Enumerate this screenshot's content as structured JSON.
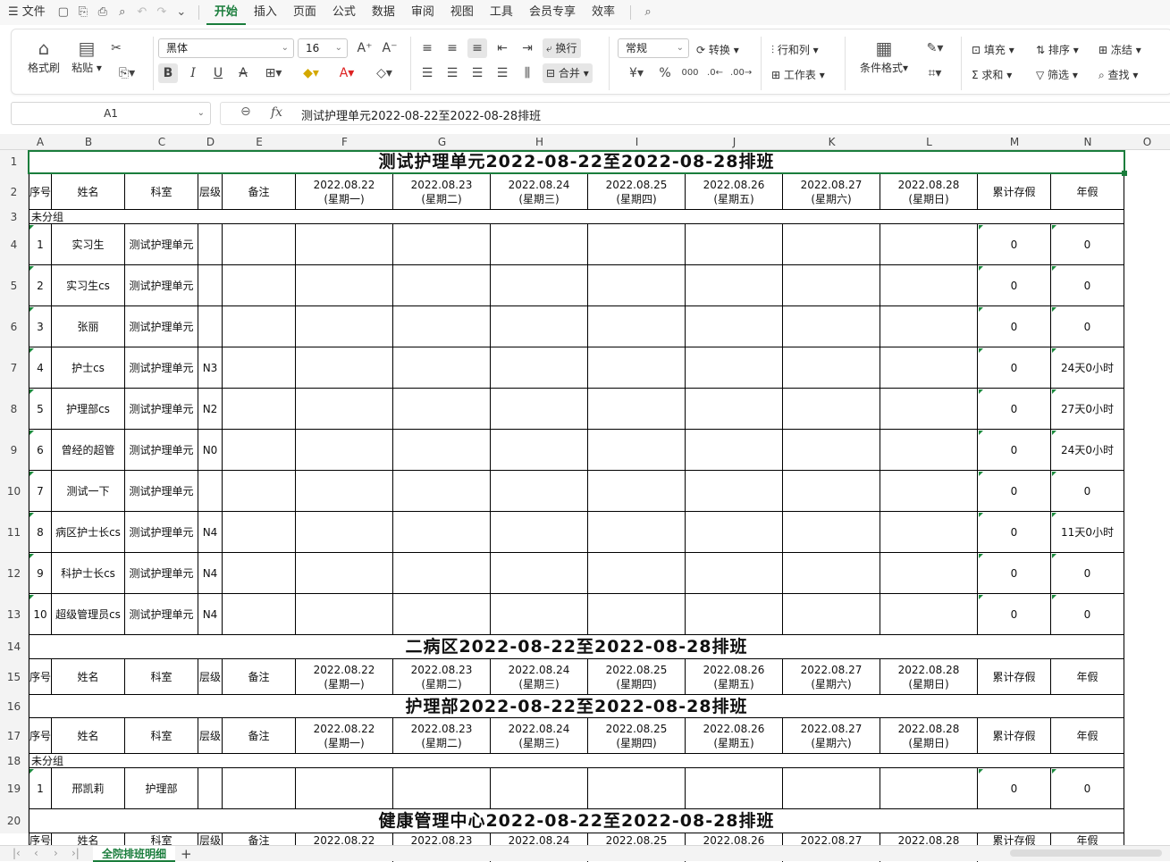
{
  "menu": {
    "file": "文件",
    "tabs": [
      "开始",
      "插入",
      "页面",
      "公式",
      "数据",
      "审阅",
      "视图",
      "工具",
      "会员专享",
      "效率"
    ],
    "active_tab": "开始"
  },
  "ribbon": {
    "format_painter": "格式刷",
    "paste": "粘贴",
    "font_name": "黑体",
    "font_size": "16",
    "wrap": "换行",
    "merge": "合并",
    "number_format": "常规",
    "convert": "转换",
    "row_col": "行和列",
    "worksheet": "工作表",
    "cond_format": "条件格式",
    "fill": "填充",
    "sort": "排序",
    "freeze": "冻结",
    "sum": "求和",
    "filter": "筛选",
    "find": "查找",
    "accent_color": "#1a7d3c"
  },
  "formula_bar": {
    "name_box": "A1",
    "fx_label": "fx",
    "content": "测试护理单元2022-08-22至2022-08-28排班"
  },
  "columns": [
    "A",
    "B",
    "C",
    "D",
    "E",
    "F",
    "G",
    "H",
    "I",
    "J",
    "K",
    "L",
    "M",
    "N",
    "O"
  ],
  "header_labels": {
    "seq": "序号",
    "name": "姓名",
    "dept": "科室",
    "level": "层级",
    "note": "备注",
    "dates": [
      "2022.08.22",
      "2022.08.23",
      "2022.08.24",
      "2022.08.25",
      "2022.08.26",
      "2022.08.27",
      "2022.08.28"
    ],
    "weekdays": [
      "(星期一)",
      "(星期二)",
      "(星期三)",
      "(星期四)",
      "(星期五)",
      "(星期六)",
      "(星期日)"
    ],
    "accum": "累计存假",
    "annual": "年假"
  },
  "group_label": "未分组",
  "sections": [
    {
      "title": "测试护理单元2022-08-22至2022-08-28排班"
    },
    {
      "title": "二病区2022-08-22至2022-08-28排班"
    },
    {
      "title": "护理部2022-08-22至2022-08-28排班"
    },
    {
      "title": "健康管理中心2022-08-22至2022-08-28排班"
    }
  ],
  "staff_rows": [
    {
      "seq": "1",
      "name": "实习生",
      "dept": "测试护理单元",
      "level": "",
      "accum": "0",
      "annual": "0"
    },
    {
      "seq": "2",
      "name": "实习生cs",
      "dept": "测试护理单元",
      "level": "",
      "accum": "0",
      "annual": "0"
    },
    {
      "seq": "3",
      "name": "张丽",
      "dept": "测试护理单元",
      "level": "",
      "accum": "0",
      "annual": "0"
    },
    {
      "seq": "4",
      "name": "护士cs",
      "dept": "测试护理单元",
      "level": "N3",
      "accum": "0",
      "annual": "24天0小时"
    },
    {
      "seq": "5",
      "name": "护理部cs",
      "dept": "测试护理单元",
      "level": "N2",
      "accum": "0",
      "annual": "27天0小时"
    },
    {
      "seq": "6",
      "name": "曾经的超管",
      "dept": "测试护理单元",
      "level": "N0",
      "accum": "0",
      "annual": "24天0小时"
    },
    {
      "seq": "7",
      "name": "测试一下",
      "dept": "测试护理单元",
      "level": "",
      "accum": "0",
      "annual": "0"
    },
    {
      "seq": "8",
      "name": "病区护士长cs",
      "dept": "测试护理单元",
      "level": "N4",
      "accum": "0",
      "annual": "11天0小时"
    },
    {
      "seq": "9",
      "name": "科护士长cs",
      "dept": "测试护理单元",
      "level": "N4",
      "accum": "0",
      "annual": "0"
    },
    {
      "seq": "10",
      "name": "超级管理员cs",
      "dept": "测试护理单元",
      "level": "N4",
      "accum": "0",
      "annual": "0"
    }
  ],
  "nursing_rows": [
    {
      "seq": "1",
      "name": "邢凯莉",
      "dept": "护理部",
      "level": "",
      "accum": "0",
      "annual": "0"
    }
  ],
  "row_numbers": [
    "1",
    "2",
    "3",
    "4",
    "5",
    "6",
    "7",
    "8",
    "9",
    "10",
    "11",
    "12",
    "13",
    "14",
    "15",
    "16",
    "17",
    "18",
    "19",
    "20"
  ],
  "sheet_tab": "全院排班明细",
  "add_sheet": "+"
}
